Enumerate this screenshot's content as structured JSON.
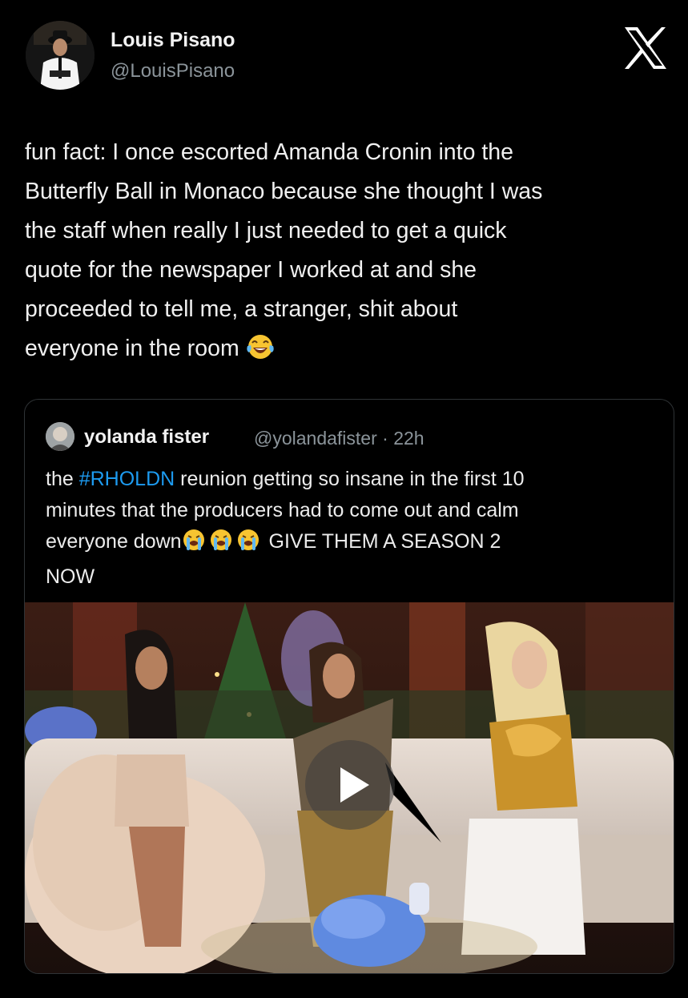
{
  "author": {
    "name": "Louis Pisano",
    "handle": "@LouisPisano"
  },
  "platform_logo": "x-logo",
  "tweet": {
    "lines": [
      "fun fact: I once escorted Amanda Cronin into the",
      "Butterfly Ball in Monaco because she thought I was",
      "the staff when really I just needed to get a quick",
      "quote for the newspaper I worked at and she",
      "proceeded to tell me, a stranger, shit about",
      "everyone in the room"
    ],
    "emoji": "face-with-tears-of-joy"
  },
  "quoted": {
    "name": "yolanda fister",
    "handle_time": "@yolandafister · 22h",
    "text_start": "the ",
    "hashtag": "#RHOLDN",
    "text_line1_rest": " reunion getting so insane in the first 10",
    "text_line2": "minutes that the producers had to come out and calm",
    "text_line3_start": "everyone down",
    "emojis": [
      "loudly-crying-face",
      "loudly-crying-face",
      "loudly-crying-face"
    ],
    "text_line3_rest": "GIVE THEM A SEASON 2",
    "text_line4": "NOW",
    "media": {
      "type": "video",
      "play_icon": "play-icon"
    }
  }
}
